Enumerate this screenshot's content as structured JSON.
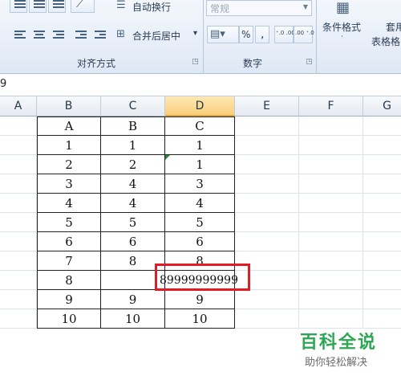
{
  "ribbon": {
    "wrap_text_label": "自动换行",
    "merge_center_label": "合并后居中",
    "merge_arrow": "▾",
    "alignment_group_label": "对齐方式",
    "number_format_value": "常规",
    "percent_label": "%",
    "comma_label": ",",
    "inc_decimal_label": "⁺.0 .00",
    "dec_decimal_label": ".00 ⁺.0",
    "number_group_label": "数字",
    "conditional_format_label": "条件格式",
    "format_table_label_1": "套用",
    "format_table_label_2": "表格格",
    "launcher_glyph": "◳"
  },
  "formula_bar": {
    "content": "9"
  },
  "columns": [
    "A",
    "B",
    "C",
    "D",
    "E",
    "F",
    "G"
  ],
  "table": {
    "rows": [
      [
        "A",
        "B",
        "C"
      ],
      [
        "1",
        "1",
        "1"
      ],
      [
        "2",
        "2",
        "1"
      ],
      [
        "3",
        "4",
        "3"
      ],
      [
        "4",
        "4",
        "4"
      ],
      [
        "5",
        "5",
        "5"
      ],
      [
        "6",
        "6",
        "6"
      ],
      [
        "7",
        "8",
        "8"
      ],
      [
        "8",
        "",
        "9"
      ],
      [
        "9",
        "9",
        "9"
      ],
      [
        "10",
        "10",
        "10"
      ]
    ],
    "overflow_value": "89999999999"
  },
  "watermark": {
    "title": "百科全说",
    "subtitle": "助你轻松解决"
  },
  "colors": {
    "highlight": "#e11d23",
    "selected_header": "#f8cf7a",
    "watermark": "#2ea653"
  }
}
